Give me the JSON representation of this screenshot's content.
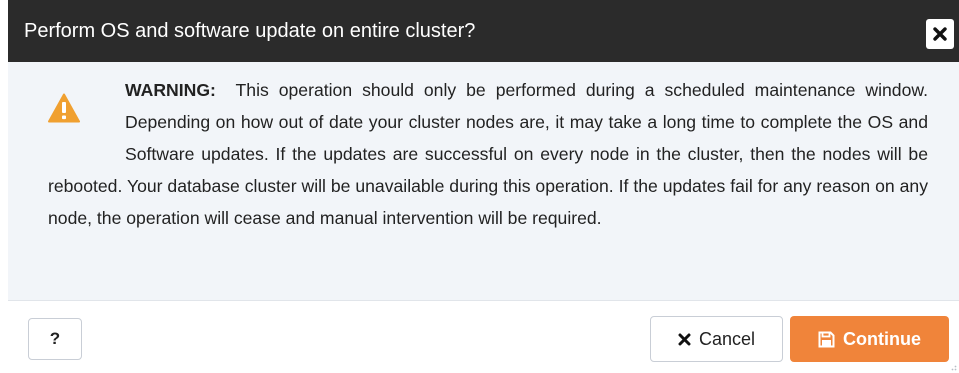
{
  "dialog": {
    "title": "Perform OS and software update on entire cluster?",
    "close_icon": "close-icon",
    "warning_icon": "warning-triangle-icon",
    "warning_label": "WARNING:",
    "message": "This operation should only be performed during a scheduled maintenance window. Depending on how out of date your cluster nodes are, it may take a long time to complete the OS and Software updates. If the updates are successful on every node in the cluster, then the nodes will be rebooted. Your database cluster will be unavailable during this operation. If the updates fail for any reason on any node, the operation will cease and manual intervention will be required."
  },
  "footer": {
    "help_label": "?",
    "cancel_label": "Cancel",
    "cancel_icon": "x-icon",
    "continue_label": "Continue",
    "continue_icon": "save-icon"
  },
  "colors": {
    "titlebar_bg": "#2b2b2b",
    "body_bg": "#f2f5f9",
    "warning": "#f0a030",
    "accent": "#f0843a"
  }
}
